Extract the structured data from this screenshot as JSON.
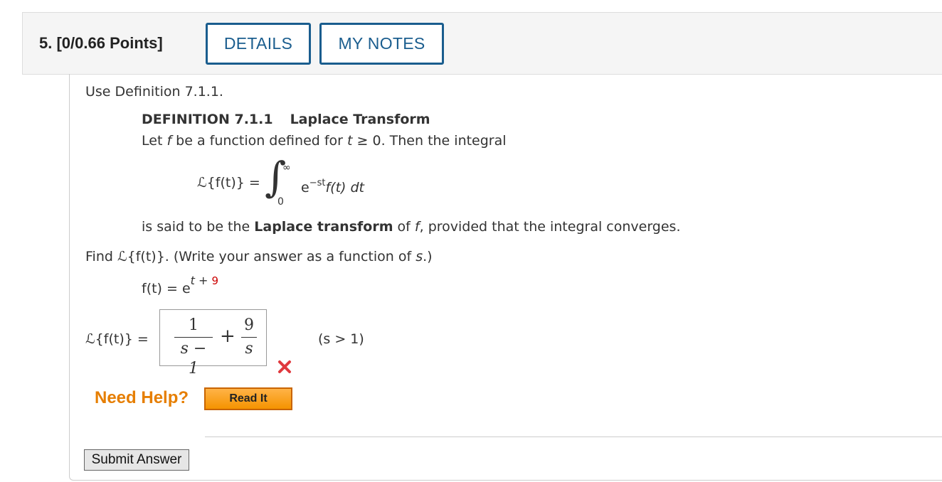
{
  "question": {
    "number_label": "5.",
    "points_label": "[0/0.66 Points]",
    "details_button": "DETAILS",
    "notes_button": "MY NOTES"
  },
  "intro": "Use Definition 7.1.1.",
  "definition": {
    "id": "DEFINITION 7.1.1",
    "name": "Laplace Transform",
    "line1_a": "Let ",
    "line1_f": "f",
    "line1_b": " be a function defined for ",
    "line1_t": "t",
    "line1_c": " ≥ 0. Then the integral",
    "integral_lhs": "ℒ{f(t)} =",
    "integral_upper": "∞",
    "integral_lower": "0",
    "integrand_e": "e",
    "integrand_exp": "−st",
    "integrand_rest": "f(t) dt",
    "line2_a": "is said to be the ",
    "line2_bold": "Laplace transform",
    "line2_b": " of ",
    "line2_f": "f",
    "line2_c": ", provided that the integral converges."
  },
  "prompt": {
    "text_a": "Find ℒ{f(t)}. (Write your answer as a function of ",
    "text_s": "s",
    "text_b": ".)"
  },
  "given": {
    "lhs": "f(t) = e",
    "exp_t": "t",
    "exp_plus": " + ",
    "exp_num": "9"
  },
  "answer": {
    "label": "ℒ{f(t)} =",
    "frac1_num": "1",
    "frac1_den": "s − 1",
    "plus": "+",
    "frac2_num": "9",
    "frac2_den": "s",
    "condition": "(s > 1)",
    "status": "incorrect",
    "status_color": "#e0393e"
  },
  "help": {
    "label": "Need Help?",
    "read_it": "Read It"
  },
  "submit_label": "Submit Answer",
  "colors": {
    "accent": "#1a5d8e",
    "help_orange": "#e67e00",
    "error_red": "#cc0000"
  }
}
